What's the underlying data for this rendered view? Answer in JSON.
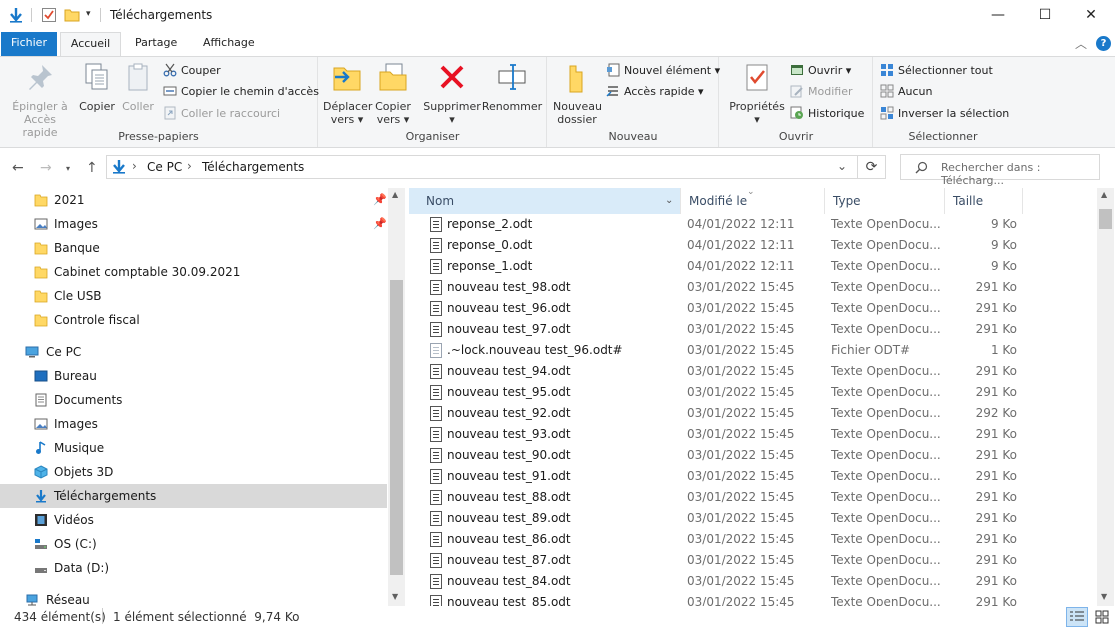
{
  "window": {
    "title": "Téléchargements",
    "minimize": "—",
    "maximize": "☐",
    "close": "✕"
  },
  "tabs": [
    "Fichier",
    "Accueil",
    "Partage",
    "Affichage"
  ],
  "ribbon": {
    "presse_papiers": {
      "label": "Presse-papiers",
      "epingler_l1": "Épingler à",
      "epingler_l2": "Accès rapide",
      "copier": "Copier",
      "coller": "Coller",
      "couper": "Couper",
      "copier_chemin": "Copier le chemin d'accès",
      "coller_raccourci": "Coller le raccourci"
    },
    "organiser": {
      "label": "Organiser",
      "deplacer_l1": "Déplacer",
      "deplacer_l2": "vers ▾",
      "copier_l1": "Copier",
      "copier_l2": "vers ▾",
      "supprimer": "Supprimer",
      "supprimer_arrow": "▾",
      "renommer": "Renommer"
    },
    "nouveau": {
      "label": "Nouveau",
      "dossier_l1": "Nouveau",
      "dossier_l2": "dossier",
      "nouvel_element": "Nouvel élément ▾",
      "acces_rapide": "Accès rapide ▾"
    },
    "ouvrir": {
      "label": "Ouvrir",
      "proprietes": "Propriétés",
      "proprietes_arrow": "▾",
      "ouvrir": "Ouvrir ▾",
      "modifier": "Modifier",
      "historique": "Historique"
    },
    "selectionner": {
      "label": "Sélectionner",
      "tout": "Sélectionner tout",
      "aucun": "Aucun",
      "inverser": "Inverser la sélection"
    }
  },
  "address": {
    "segments": [
      "Ce PC",
      "Téléchargements"
    ],
    "separator": "›",
    "search_placeholder": "Rechercher dans : Télécharg..."
  },
  "nav": {
    "items": [
      {
        "label": "2021",
        "icon": "folder-icon",
        "pinned": true
      },
      {
        "label": "Images",
        "icon": "images-icon",
        "pinned": true
      },
      {
        "label": "Banque",
        "icon": "folder-icon"
      },
      {
        "label": "Cabinet comptable 30.09.2021",
        "icon": "folder-icon"
      },
      {
        "label": "Cle USB",
        "icon": "folder-icon"
      },
      {
        "label": "Controle fiscal",
        "icon": "folder-icon"
      },
      {
        "label": "Ce PC",
        "icon": "pc-icon"
      },
      {
        "label": "Bureau",
        "icon": "desktop-icon"
      },
      {
        "label": "Documents",
        "icon": "documents-icon"
      },
      {
        "label": "Images",
        "icon": "images-icon"
      },
      {
        "label": "Musique",
        "icon": "music-icon"
      },
      {
        "label": "Objets 3D",
        "icon": "3d-objects-icon"
      },
      {
        "label": "Téléchargements",
        "icon": "download-icon",
        "selected": true
      },
      {
        "label": "Vidéos",
        "icon": "video-icon"
      },
      {
        "label": "OS (C:)",
        "icon": "drive-icon"
      },
      {
        "label": "Data (D:)",
        "icon": "drive-icon"
      },
      {
        "label": "Réseau",
        "icon": "network-icon"
      }
    ]
  },
  "columns": {
    "name": "Nom",
    "date": "Modifié le",
    "type": "Type",
    "size": "Taille"
  },
  "files": [
    {
      "name": "reponse_2.odt",
      "date": "04/01/2022 12:11",
      "type": "Texte OpenDocu...",
      "size": "9 Ko"
    },
    {
      "name": "reponse_0.odt",
      "date": "04/01/2022 12:11",
      "type": "Texte OpenDocu...",
      "size": "9 Ko"
    },
    {
      "name": "reponse_1.odt",
      "date": "04/01/2022 12:11",
      "type": "Texte OpenDocu...",
      "size": "9 Ko"
    },
    {
      "name": "nouveau test_98.odt",
      "date": "03/01/2022 15:45",
      "type": "Texte OpenDocu...",
      "size": "291 Ko"
    },
    {
      "name": "nouveau test_96.odt",
      "date": "03/01/2022 15:45",
      "type": "Texte OpenDocu...",
      "size": "291 Ko"
    },
    {
      "name": "nouveau test_97.odt",
      "date": "03/01/2022 15:45",
      "type": "Texte OpenDocu...",
      "size": "291 Ko"
    },
    {
      "name": ".~lock.nouveau test_96.odt#",
      "date": "03/01/2022 15:45",
      "type": "Fichier ODT#",
      "size": "1 Ko",
      "lock": true
    },
    {
      "name": "nouveau test_94.odt",
      "date": "03/01/2022 15:45",
      "type": "Texte OpenDocu...",
      "size": "291 Ko"
    },
    {
      "name": "nouveau test_95.odt",
      "date": "03/01/2022 15:45",
      "type": "Texte OpenDocu...",
      "size": "291 Ko"
    },
    {
      "name": "nouveau test_92.odt",
      "date": "03/01/2022 15:45",
      "type": "Texte OpenDocu...",
      "size": "292 Ko"
    },
    {
      "name": "nouveau test_93.odt",
      "date": "03/01/2022 15:45",
      "type": "Texte OpenDocu...",
      "size": "291 Ko"
    },
    {
      "name": "nouveau test_90.odt",
      "date": "03/01/2022 15:45",
      "type": "Texte OpenDocu...",
      "size": "291 Ko"
    },
    {
      "name": "nouveau test_91.odt",
      "date": "03/01/2022 15:45",
      "type": "Texte OpenDocu...",
      "size": "291 Ko"
    },
    {
      "name": "nouveau test_88.odt",
      "date": "03/01/2022 15:45",
      "type": "Texte OpenDocu...",
      "size": "291 Ko"
    },
    {
      "name": "nouveau test_89.odt",
      "date": "03/01/2022 15:45",
      "type": "Texte OpenDocu...",
      "size": "291 Ko"
    },
    {
      "name": "nouveau test_86.odt",
      "date": "03/01/2022 15:45",
      "type": "Texte OpenDocu...",
      "size": "291 Ko"
    },
    {
      "name": "nouveau test_87.odt",
      "date": "03/01/2022 15:45",
      "type": "Texte OpenDocu...",
      "size": "291 Ko"
    },
    {
      "name": "nouveau test_84.odt",
      "date": "03/01/2022 15:45",
      "type": "Texte OpenDocu...",
      "size": "291 Ko"
    },
    {
      "name": "nouveau test_85.odt",
      "date": "03/01/2022 15:45",
      "type": "Texte OpenDocu...",
      "size": "291 Ko"
    }
  ],
  "status": {
    "count": "434 élément(s)",
    "selection": "1 élément sélectionné  9,74 Ko"
  },
  "colors": {
    "accent": "#1979ca",
    "selected_bg": "#d9d9d9",
    "header_hover": "#d9ebf9",
    "folder": "#ffd865",
    "delete_red": "#e81123"
  }
}
